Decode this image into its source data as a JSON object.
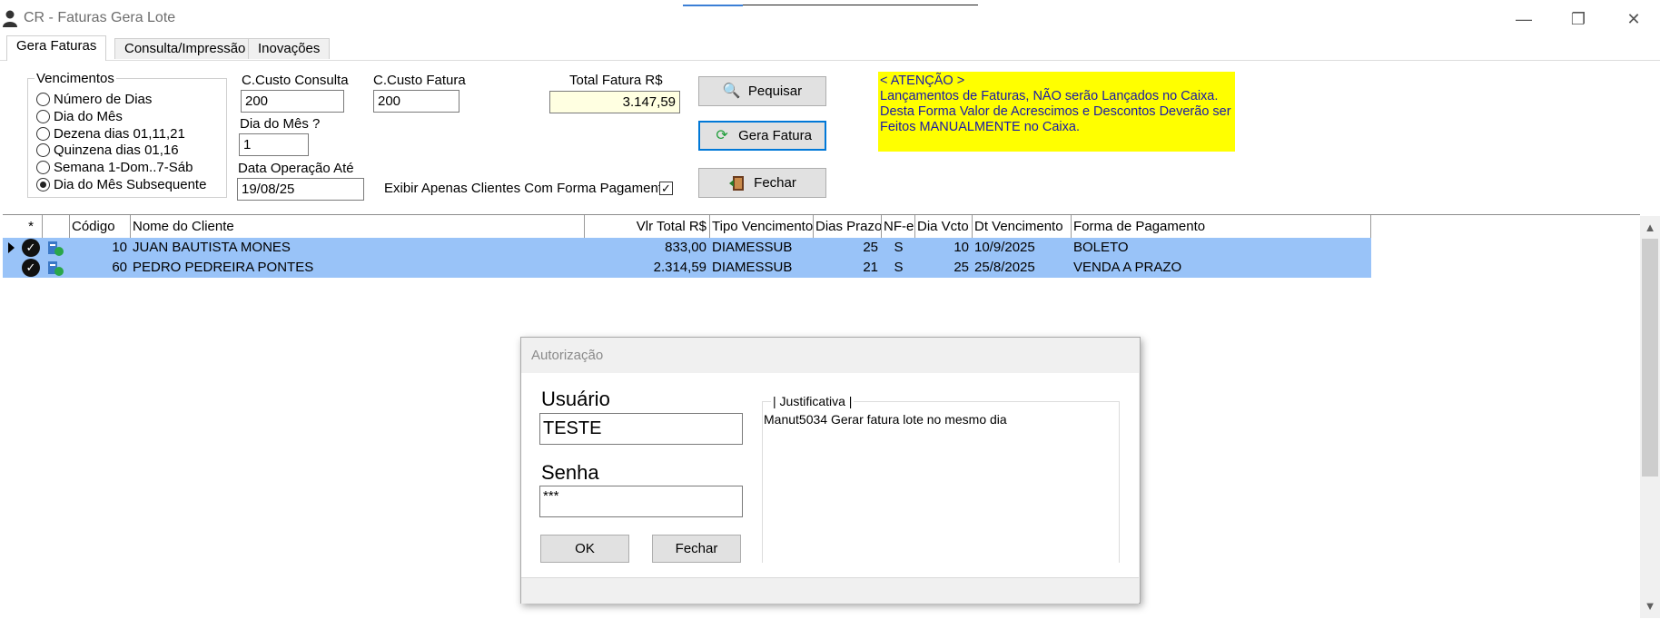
{
  "window": {
    "title": "CR - Faturas Gera Lote",
    "minimize": "—",
    "restore": "❐",
    "close": "✕"
  },
  "tabs": [
    {
      "label": "Gera Faturas",
      "active": true
    },
    {
      "label": "Consulta/Impressão",
      "active": false
    },
    {
      "label": "Inovações",
      "active": false
    }
  ],
  "vencimentos": {
    "legend": "Vencimentos",
    "options": [
      {
        "label": "Número de Dias",
        "selected": false
      },
      {
        "label": "Dia do Mês",
        "selected": false
      },
      {
        "label": "Dezena dias 01,11,21",
        "selected": false
      },
      {
        "label": "Quinzena dias 01,16",
        "selected": false
      },
      {
        "label": "Semana 1-Dom..7-Sáb",
        "selected": false
      },
      {
        "label": "Dia do Mês Subsequente",
        "selected": true
      }
    ]
  },
  "form": {
    "ccusto_consulta_label": "C.Custo Consulta",
    "ccusto_consulta_value": "200",
    "ccusto_fatura_label": "C.Custo Fatura",
    "ccusto_fatura_value": "200",
    "dia_mes_label": "Dia do Mês ?",
    "dia_mes_value": "1",
    "data_operacao_label": "Data Operação Até",
    "data_operacao_value": "19/08/25",
    "total_fatura_label": "Total Fatura R$",
    "total_fatura_value": "3.147,59",
    "exibir_label": "Exibir Apenas Clientes Com Forma Pagamento",
    "exibir_checked": "✓"
  },
  "buttons": {
    "pesquisar": "Pequisar",
    "gera_fatura": "Gera Fatura",
    "fechar": "Fechar"
  },
  "attention": {
    "lines": [
      "< ATENÇÃO >",
      "Lançamentos de Faturas, NÃO serão Lançados no Caixa.",
      "Desta Forma Valor de Acrescimos e Descontos Deverão ser",
      "Feitos MANUALMENTE no Caixa."
    ]
  },
  "grid": {
    "columns": [
      "*",
      "",
      "Código",
      "Nome do Cliente",
      "Vlr Total R$",
      "Tipo Vencimento",
      "Dias Prazo",
      "NF-e",
      "Dia Vcto",
      "Dt Vencimento",
      "Forma de Pagamento"
    ],
    "rows": [
      {
        "codigo": "10",
        "nome": "JUAN BAUTISTA MONES",
        "vlr": "833,00",
        "tipo": "DIAMESSUB",
        "dias": "25",
        "nfe": "S",
        "dia_vcto": "10",
        "dt_venc": "10/9/2025",
        "forma": "BOLETO"
      },
      {
        "codigo": "60",
        "nome": "PEDRO PEDREIRA PONTES",
        "vlr": "2.314,59",
        "tipo": "DIAMESSUB",
        "dias": "21",
        "nfe": "S",
        "dia_vcto": "25",
        "dt_venc": "25/8/2025",
        "forma": "VENDA A PRAZO"
      }
    ]
  },
  "dialog": {
    "title": "Autorização",
    "usuario_label": "Usuário",
    "usuario_value": "TESTE",
    "senha_label": "Senha",
    "senha_value": "***",
    "ok": "OK",
    "fechar": "Fechar",
    "justificativa_label": "| Justificativa |",
    "justificativa_text": "Manut5034 Gerar fatura lote no mesmo dia"
  },
  "scrollbar": {
    "up": "▲",
    "down": "▼"
  }
}
